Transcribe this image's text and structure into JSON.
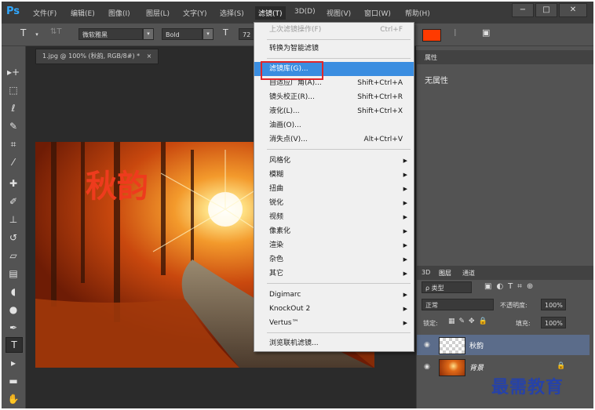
{
  "app": {
    "logo": "Ps"
  },
  "menubar": {
    "items": [
      "文件(F)",
      "编辑(E)",
      "图像(I)",
      "图层(L)",
      "文字(Y)",
      "选择(S)",
      "滤镜(T)",
      "3D(D)",
      "视图(V)",
      "窗口(W)",
      "帮助(H)"
    ],
    "active_index": 6,
    "window_buttons": [
      "−",
      "□",
      "✕"
    ]
  },
  "options": {
    "tool_glyph": "T",
    "orient_glyph": "⇅T",
    "font_family": "微软雅黑",
    "font_style": "Bold",
    "size_glyph": "T",
    "font_size": "72",
    "color_accent": "#ff3a00"
  },
  "document": {
    "tab_title": "1.jpg @ 100% (秋韵, RGB/8#) *",
    "close_glyph": "×",
    "text_layer_content": "秋韵"
  },
  "tools": [
    {
      "name": "move-tool-icon",
      "glyph": "▸+"
    },
    {
      "name": "marquee-tool-icon",
      "glyph": "⬚"
    },
    {
      "name": "lasso-tool-icon",
      "glyph": "ℓ"
    },
    {
      "name": "quick-select-tool-icon",
      "glyph": "✎"
    },
    {
      "name": "crop-tool-icon",
      "glyph": "⌗"
    },
    {
      "name": "eyedropper-tool-icon",
      "glyph": "⁄"
    },
    {
      "name": "healing-brush-tool-icon",
      "glyph": "✚"
    },
    {
      "name": "brush-tool-icon",
      "glyph": "✐"
    },
    {
      "name": "clone-stamp-tool-icon",
      "glyph": "⊥"
    },
    {
      "name": "history-brush-tool-icon",
      "glyph": "↺"
    },
    {
      "name": "eraser-tool-icon",
      "glyph": "▱"
    },
    {
      "name": "gradient-tool-icon",
      "glyph": "▤"
    },
    {
      "name": "blur-tool-icon",
      "glyph": "◖"
    },
    {
      "name": "dodge-tool-icon",
      "glyph": "●"
    },
    {
      "name": "pen-tool-icon",
      "glyph": "✒"
    },
    {
      "name": "type-tool-icon",
      "glyph": "T"
    },
    {
      "name": "path-select-tool-icon",
      "glyph": "▸"
    },
    {
      "name": "shape-tool-icon",
      "glyph": "▬"
    },
    {
      "name": "hand-tool-icon",
      "glyph": "✋"
    }
  ],
  "selected_tool_index": 15,
  "properties_panel": {
    "tab": "属性",
    "content": "无属性"
  },
  "layers_panel": {
    "tabs": [
      "3D",
      "图层",
      "通道"
    ],
    "filter_label": "ρ 类型",
    "blend_mode": "正常",
    "opacity_label": "不透明度:",
    "opacity_value": "100%",
    "lock_label": "锁定:",
    "fill_label": "填充:",
    "fill_value": "100%",
    "layers": [
      {
        "name": "秋韵",
        "selected": true,
        "type": "text"
      },
      {
        "name": "背景",
        "selected": false,
        "type": "image",
        "locked": true
      }
    ]
  },
  "filter_menu": {
    "items": [
      {
        "label": "上次滤镜操作(F)",
        "shortcut": "Ctrl+F",
        "disabled": true
      },
      {
        "sep": true
      },
      {
        "label": "转换为智能滤镜"
      },
      {
        "sep": true
      },
      {
        "label": "滤镜库(G)...",
        "highlighted": true
      },
      {
        "label": "自适应广角(A)...",
        "shortcut": "Shift+Ctrl+A"
      },
      {
        "label": "镜头校正(R)...",
        "shortcut": "Shift+Ctrl+R"
      },
      {
        "label": "液化(L)...",
        "shortcut": "Shift+Ctrl+X"
      },
      {
        "label": "油画(O)..."
      },
      {
        "label": "消失点(V)...",
        "shortcut": "Alt+Ctrl+V"
      },
      {
        "sep": true
      },
      {
        "label": "风格化",
        "submenu": true
      },
      {
        "label": "模糊",
        "submenu": true
      },
      {
        "label": "扭曲",
        "submenu": true
      },
      {
        "label": "锐化",
        "submenu": true
      },
      {
        "label": "视频",
        "submenu": true
      },
      {
        "label": "像素化",
        "submenu": true
      },
      {
        "label": "渲染",
        "submenu": true
      },
      {
        "label": "杂色",
        "submenu": true
      },
      {
        "label": "其它",
        "submenu": true
      },
      {
        "sep": true
      },
      {
        "label": "Digimarc",
        "submenu": true
      },
      {
        "label": "KnockOut 2",
        "submenu": true
      },
      {
        "label": "Vertus™",
        "submenu": true
      },
      {
        "sep": true
      },
      {
        "label": "浏览联机滤镜..."
      }
    ]
  },
  "watermark": "最需教育"
}
